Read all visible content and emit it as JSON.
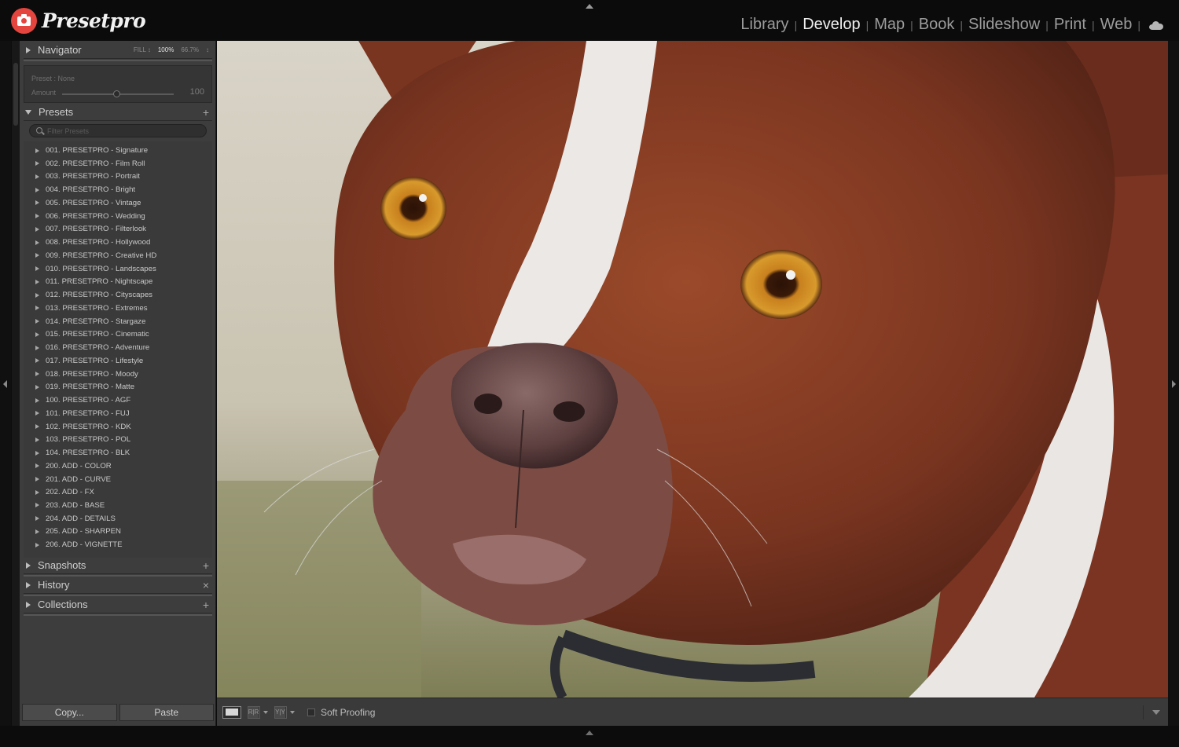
{
  "app": {
    "logo_text": "Presetpro"
  },
  "modules": [
    "Library",
    "Develop",
    "Map",
    "Book",
    "Slideshow",
    "Print",
    "Web"
  ],
  "active_module": "Develop",
  "navigator": {
    "label": "Navigator",
    "zoom_options": [
      "FILL ↕",
      "100%",
      "66.7%",
      "↕"
    ],
    "selected_zoom": "100%"
  },
  "preset_amount": {
    "preset_label": "Preset : None",
    "amount_label": "Amount",
    "amount_value": "100",
    "amount_fraction": 0.49
  },
  "presets": {
    "label": "Presets",
    "add_symbol": "+",
    "filter_placeholder": "Filter Presets",
    "items": [
      "001. PRESETPRO - Signature",
      "002. PRESETPRO - Film Roll",
      "003. PRESETPRO - Portrait",
      "004. PRESETPRO - Bright",
      "005. PRESETPRO - Vintage",
      "006. PRESETPRO - Wedding",
      "007. PRESETPRO - Filterlook",
      "008. PRESETPRO - Hollywood",
      "009. PRESETPRO - Creative HD",
      "010. PRESETPRO - Landscapes",
      "011. PRESETPRO - Nightscape",
      "012. PRESETPRO - Cityscapes",
      "013. PRESETPRO - Extremes",
      "014. PRESETPRO - Stargaze",
      "015. PRESETPRO - Cinematic",
      "016. PRESETPRO - Adventure",
      "017. PRESETPRO - Lifestyle",
      "018. PRESETPRO - Moody",
      "019. PRESETPRO - Matte",
      "100. PRESETPRO - AGF",
      "101. PRESETPRO - FUJ",
      "102. PRESETPRO - KDK",
      "103. PRESETPRO - POL",
      "104. PRESETPRO - BLK",
      "200. ADD - COLOR",
      "201. ADD - CURVE",
      "202. ADD - FX",
      "203. ADD - BASE",
      "204. ADD - DETAILS",
      "205. ADD - SHARPEN",
      "206. ADD - VIGNETTE"
    ]
  },
  "snapshots": {
    "label": "Snapshots",
    "action": "+"
  },
  "history": {
    "label": "History",
    "action": "×"
  },
  "collections": {
    "label": "Collections",
    "action": "+"
  },
  "buttons": {
    "copy": "Copy...",
    "paste": "Paste"
  },
  "toolbar": {
    "soft_proofing": "Soft Proofing",
    "before_after_a": "R|R",
    "before_after_b": "Y|Y"
  },
  "colors": {
    "brand_red": "#e5453f",
    "panel_bg": "#3d3d3d",
    "active_module": "#f0f0f0",
    "inactive_module": "#9c9c9c"
  }
}
